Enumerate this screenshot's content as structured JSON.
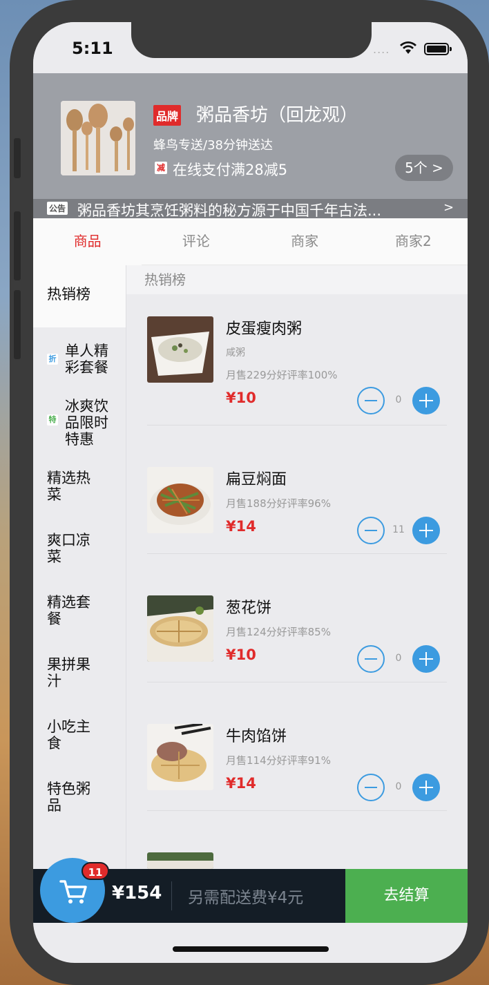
{
  "status_bar": {
    "time": "5:11",
    "signal": "...."
  },
  "shop": {
    "brand_tag": "品牌",
    "name": "粥品香坊（回龙观）",
    "delivery": "蜂鸟专送/38分钟送达",
    "promo_tag": "减",
    "promo_text": "在线支付满28减5",
    "promo_count": "5个 >"
  },
  "notice": {
    "tag": "公告",
    "text": "粥品香坊其烹饪粥料的秘方源于中国千年古法...",
    "arrow": ">"
  },
  "tabs": [
    {
      "label": "商品",
      "active": true
    },
    {
      "label": "评论",
      "active": false
    },
    {
      "label": "商家",
      "active": false
    },
    {
      "label": "商家2",
      "active": false
    }
  ],
  "categories": [
    {
      "label": "热销榜",
      "badge": ""
    },
    {
      "label": "单人精彩套餐",
      "badge": "折"
    },
    {
      "label": "冰爽饮品限时特惠",
      "badge": "特"
    },
    {
      "label": "精选热菜",
      "badge": ""
    },
    {
      "label": "爽口凉菜",
      "badge": ""
    },
    {
      "label": "精选套餐",
      "badge": ""
    },
    {
      "label": "果拼果汁",
      "badge": ""
    },
    {
      "label": "小吃主食",
      "badge": ""
    },
    {
      "label": "特色粥品",
      "badge": ""
    }
  ],
  "section_title": "热销榜",
  "items": [
    {
      "name": "皮蛋瘦肉粥",
      "desc": "咸粥",
      "sales": "月售229分好评率100%",
      "price": "¥10",
      "qty": "0"
    },
    {
      "name": "扁豆焖面",
      "desc": "",
      "sales": "月售188分好评率96%",
      "price": "¥14",
      "qty": "11"
    },
    {
      "name": "葱花饼",
      "desc": "",
      "sales": "月售124分好评率85%",
      "price": "¥10",
      "qty": "0"
    },
    {
      "name": "牛肉馅饼",
      "desc": "",
      "sales": "月售114分好评率91%",
      "price": "¥14",
      "qty": "0"
    }
  ],
  "cart": {
    "count": "11",
    "total": "¥154",
    "delivery_fee": "另需配送费¥4元",
    "checkout_label": "去结算"
  },
  "colors": {
    "accent_red": "#e02b2b",
    "accent_blue": "#3c9be0",
    "checkout_green": "#4caf50"
  }
}
